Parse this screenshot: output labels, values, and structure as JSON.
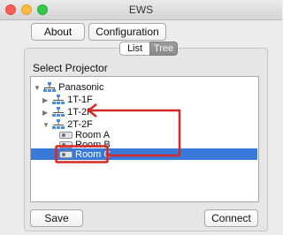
{
  "window": {
    "title": "EWS"
  },
  "toolbar": {
    "about_label": "About",
    "configuration_label": "Configuration"
  },
  "view_toggle": {
    "list_label": "List",
    "tree_label": "Tree",
    "selected": "Tree"
  },
  "select_label": "Select Projector",
  "tree": {
    "root": "Panasonic",
    "floors": [
      "1T-1F",
      "1T-2F",
      "2T-2F"
    ],
    "rooms": [
      "Room A",
      "Room B",
      "Room C"
    ],
    "selected_item": "Room C"
  },
  "footer": {
    "save_label": "Save",
    "connect_label": "Connect"
  },
  "annotation_color": "#d42a27",
  "selection_color": "#3879d9"
}
